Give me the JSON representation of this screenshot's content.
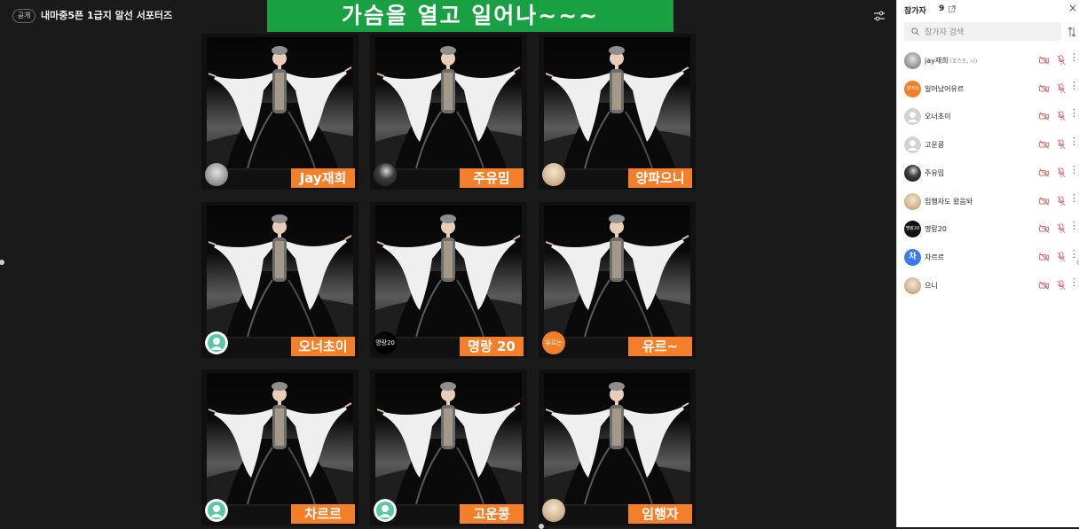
{
  "header": {
    "visibility_badge": "공개",
    "room_title": "내마중5픈 1급지 알선 서포터즈",
    "banner": "가슴을 열고 일어나~~~"
  },
  "tiles": [
    {
      "name": "Jay재희",
      "avatar": "photo-gray"
    },
    {
      "name": "주유밈",
      "avatar": "photo-dark"
    },
    {
      "name": "양파으니",
      "avatar": "photo-tan"
    },
    {
      "name": "오너초이",
      "avatar": "default-green"
    },
    {
      "name": "명랑 20",
      "avatar": "text",
      "avatar_text": "명랑20"
    },
    {
      "name": "유르~",
      "avatar": "text",
      "avatar_text": "유르는"
    },
    {
      "name": "차르르",
      "avatar": "default-green"
    },
    {
      "name": "고운콩",
      "avatar": "default-green"
    },
    {
      "name": "임행자",
      "avatar": "photo-tan"
    }
  ],
  "sidebar": {
    "title": "참가자",
    "count": "9",
    "search_placeholder": "참가자 검색",
    "participants": [
      {
        "name": "jay재희",
        "role": "(호스트, 나)",
        "avatar": "photo-gray"
      },
      {
        "name": "일어났어유르",
        "role": "",
        "avatar": "text",
        "avatar_text": "일어났",
        "color": "#f37f2a"
      },
      {
        "name": "오너초이",
        "role": "",
        "avatar": "default"
      },
      {
        "name": "고운콩",
        "role": "",
        "avatar": "default"
      },
      {
        "name": "주유밈",
        "role": "",
        "avatar": "photo-dark"
      },
      {
        "name": "임행자도 왔음돠",
        "role": "",
        "avatar": "photo-tan"
      },
      {
        "name": "명랑20",
        "role": "",
        "avatar": "text",
        "avatar_text": "명랑20",
        "color": "#111111"
      },
      {
        "name": "차르르",
        "role": "",
        "avatar": "text",
        "avatar_text": "차",
        "color": "#3b7be8"
      },
      {
        "name": "으니",
        "role": "",
        "avatar": "photo-tan"
      }
    ]
  },
  "colors": {
    "banner": "#19a042",
    "name_badge": "#f37f2a",
    "background": "#1a1a1a",
    "muted_icon": "#e06a6a"
  }
}
